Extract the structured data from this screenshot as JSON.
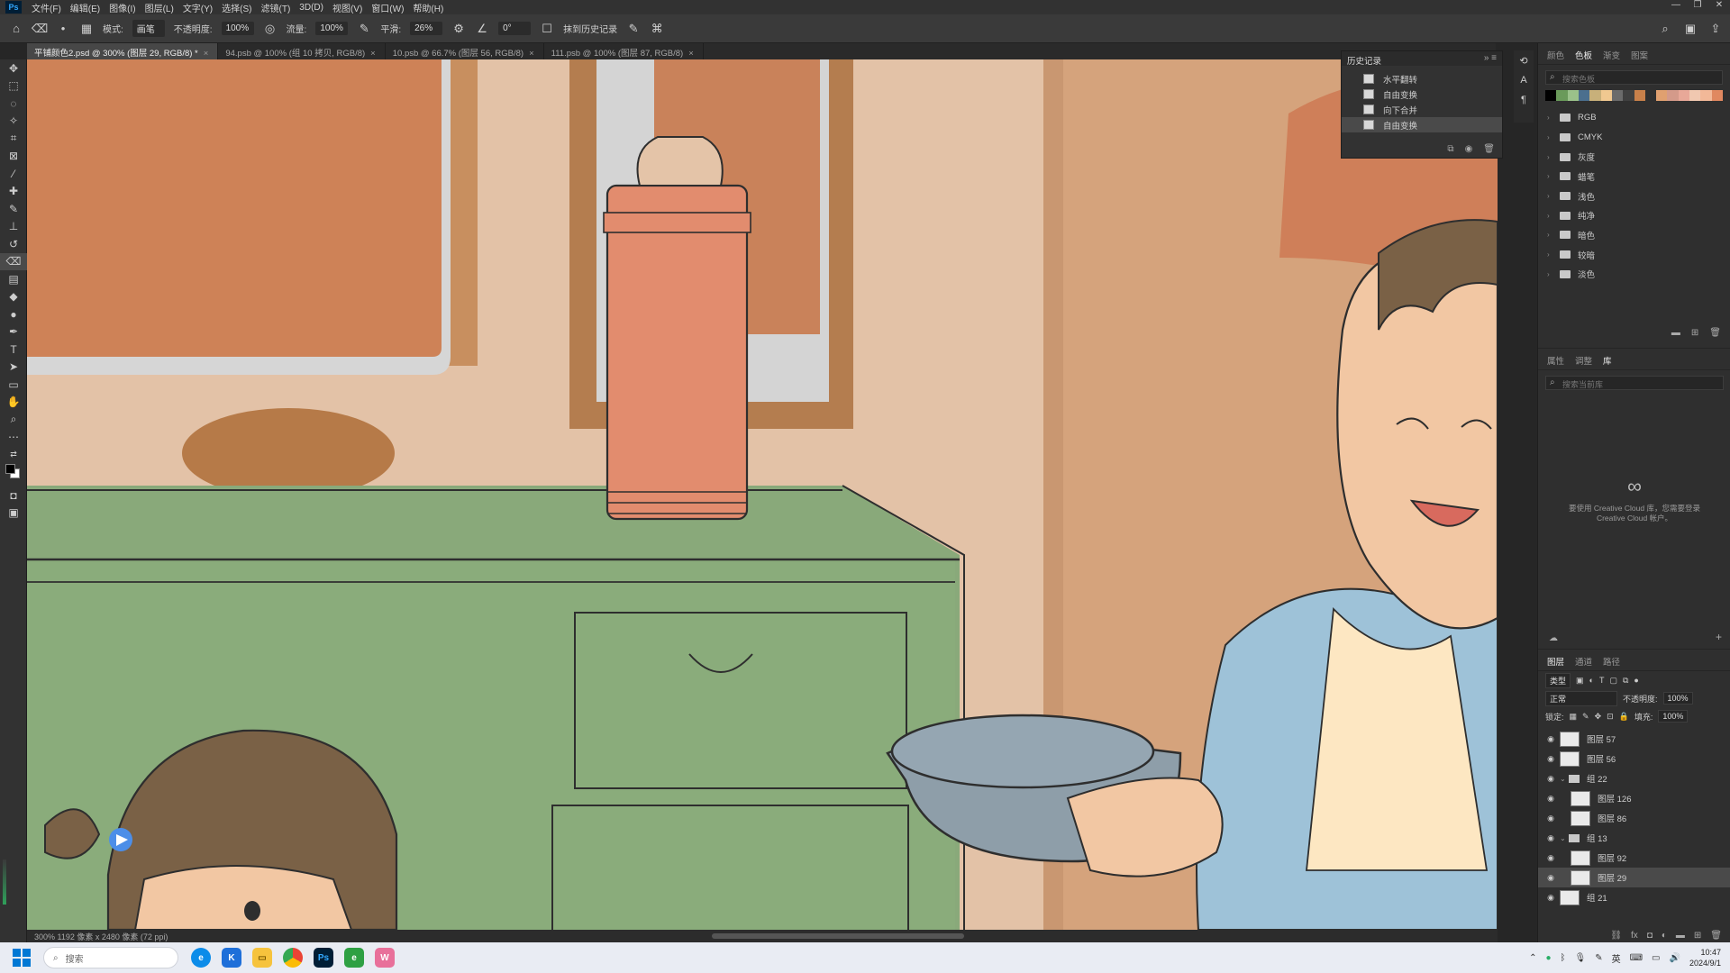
{
  "menubar": {
    "logo": "Ps",
    "items": [
      "文件(F)",
      "编辑(E)",
      "图像(I)",
      "图层(L)",
      "文字(Y)",
      "选择(S)",
      "滤镜(T)",
      "3D(D)",
      "视图(V)",
      "窗口(W)",
      "帮助(H)"
    ]
  },
  "options": {
    "mode_label": "模式:",
    "mode_value": "画笔",
    "opacity_label": "不透明度:",
    "opacity_value": "100%",
    "flow_label": "流量:",
    "flow_value": "100%",
    "smooth_label": "平滑:",
    "smooth_value": "26%",
    "angle_value": "0°",
    "erase_history_label": "抹到历史记录"
  },
  "tabs": [
    {
      "label": "平铺颜色2.psd @ 300% (图层 29, RGB/8) *",
      "active": true
    },
    {
      "label": "94.psb @ 100% (组 10 拷贝, RGB/8)",
      "active": false
    },
    {
      "label": "10.psb @ 66.7% (图层 56, RGB/8)",
      "active": false
    },
    {
      "label": "111.psb @ 100% (图层 87, RGB/8)",
      "active": false
    }
  ],
  "history": {
    "title": "历史记录",
    "items": [
      {
        "label": "水平翻转",
        "selected": false
      },
      {
        "label": "自由变换",
        "selected": false
      },
      {
        "label": "向下合并",
        "selected": false
      },
      {
        "label": "自由变换",
        "selected": true
      }
    ]
  },
  "swatches_panel": {
    "tabs": [
      "颜色",
      "色板",
      "渐变",
      "图案"
    ],
    "active_tab": "色板",
    "search_placeholder": "搜索色板",
    "colors": [
      "#000000",
      "#6a9a5a",
      "#9ac18a",
      "#4b6f8e",
      "#c8b07a",
      "#f0c890",
      "#6b6b6b",
      "#404040",
      "#c8804a",
      "#2f2f2f",
      "#e0a070",
      "#d49a8a",
      "#e8a898",
      "#f0c8b0",
      "#f2b898",
      "#e08860"
    ],
    "folders": [
      "RGB",
      "CMYK",
      "灰度",
      "蜡笔",
      "浅色",
      "纯净",
      "暗色",
      "较暗",
      "淡色"
    ]
  },
  "library_panel": {
    "tabs": [
      "属性",
      "调整",
      "库"
    ],
    "active_tab": "库",
    "search_placeholder": "搜索当前库",
    "message": "要使用 Creative Cloud 库，您需要登录 Creative Cloud 帐户。"
  },
  "layers_panel": {
    "tabs": [
      "图层",
      "通道",
      "路径"
    ],
    "active_tab": "图层",
    "filter_label": "类型",
    "blend_mode": "正常",
    "opacity_label": "不透明度:",
    "opacity_value": "100%",
    "lock_label": "锁定:",
    "fill_label": "填充:",
    "fill_value": "100%",
    "layers": [
      {
        "name": "图层 57",
        "type": "layer",
        "indent": 0,
        "selected": false
      },
      {
        "name": "图层 56",
        "type": "layer",
        "indent": 0,
        "selected": false
      },
      {
        "name": "组 22",
        "type": "group",
        "indent": 0,
        "selected": false
      },
      {
        "name": "图层 126",
        "type": "layer",
        "indent": 1,
        "selected": false
      },
      {
        "name": "图层 86",
        "type": "layer",
        "indent": 1,
        "selected": false
      },
      {
        "name": "组 13",
        "type": "group",
        "indent": 0,
        "selected": false
      },
      {
        "name": "图层 92",
        "type": "layer",
        "indent": 1,
        "selected": false
      },
      {
        "name": "图层 29",
        "type": "layer",
        "indent": 1,
        "selected": true
      },
      {
        "name": "组 21",
        "type": "layer",
        "indent": 0,
        "selected": false
      }
    ]
  },
  "status": {
    "text": "300%    1192 像素 x 2480 像素 (72 ppi)"
  },
  "taskbar": {
    "search_placeholder": "搜索",
    "lang": "英",
    "time": "10:47",
    "date": "2024/9/1"
  }
}
